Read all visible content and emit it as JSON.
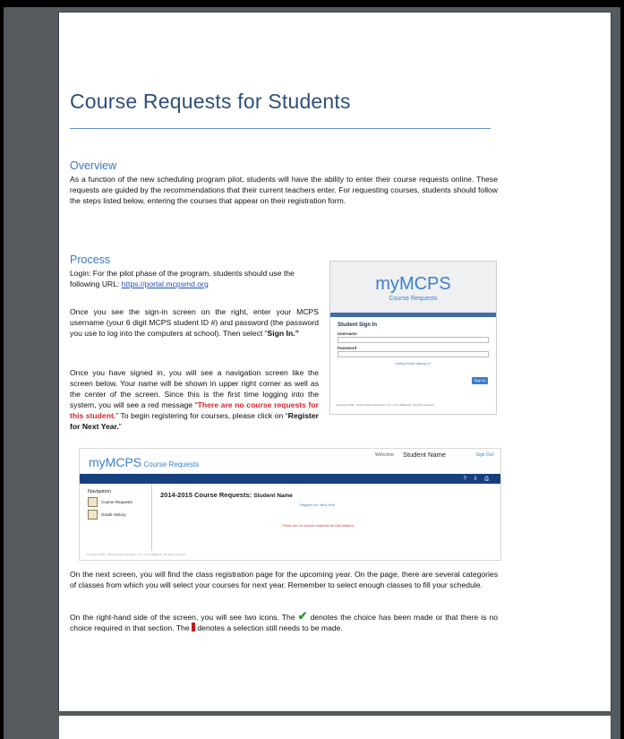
{
  "doc": {
    "title": "Course Requests for Students",
    "overview_heading": "Overview",
    "overview_text": "As a function of the new scheduling program pilot, students will have the ability to enter their course requests online. These requests are guided by the recommendations that their current teachers enter. For requesting courses, students should follow the steps listed below, entering the courses that appear on their registration form.",
    "process_heading": "Process",
    "login_text": "Login: For the pilot phase of the program, students should use the following URL: ",
    "url": "https://portal.mcpsmd.org",
    "signin_text_1": "Once you see the sign-in screen on the right, enter your MCPS username (your 6 digit MCPS student ID #) and password (the password you use to log into the computers at school). Then select “",
    "signin_bold": "Sign In.”",
    "nav_text_1": "Once you have signed in, you will see a navigation screen like the screen below.  Your name will be shown in upper right corner as well as the center of the screen.  Since this is the first time logging into the system, you will see a red message “",
    "nav_red": "There are no course requests for this student.",
    "nav_text_2": "”  To begin registering for courses, please click on “",
    "nav_bold": "Register for Next Year.",
    "nav_text_3": "”",
    "next_text": "On the next screen, you will find the class registration page for the upcoming year. On the page, there are several categories of classes from which you will select your courses for next year. Remember to select enough classes to fill your schedule.",
    "icons_text_1": "On the right-hand side of the screen, you will see two icons. The ",
    "icons_text_2": " denotes the choice has been made or that there is no choice required in that section.  The ",
    "icons_text_3": " denotes a selection still needs to be made."
  },
  "signin_shot": {
    "logo_my": "my",
    "logo_mcps": "MCPS",
    "subtitle": "Course Requests",
    "form_heading": "Student Sign In",
    "username_label": "Username",
    "password_label": "Password",
    "trouble_link": "Having trouble signing in?",
    "button": "Sign In",
    "copyright": "Copyright 2005 - 2013 Pearson Education, Inc., or its affiliate(s). All rights reserved."
  },
  "nav_shot": {
    "logo_my": "my",
    "logo_mcps": "MCPS",
    "logo_sub": " Course Requests",
    "welcome": "Welcome",
    "student_name": "Student Name",
    "sign_out": "Sign Out",
    "nav_heading": "Navigation",
    "nav_items": [
      "Course Requests",
      "Grade History"
    ],
    "main_heading": "2014-2015 Course Requests: ",
    "main_name": "Student Name",
    "register_link": "Register for Next Year",
    "no_requests": "There are no course requests for this student.",
    "copyright": "Copyright 2005 - 2013 Pearson Education, Inc., or its affiliate(s). All rights reserved."
  }
}
